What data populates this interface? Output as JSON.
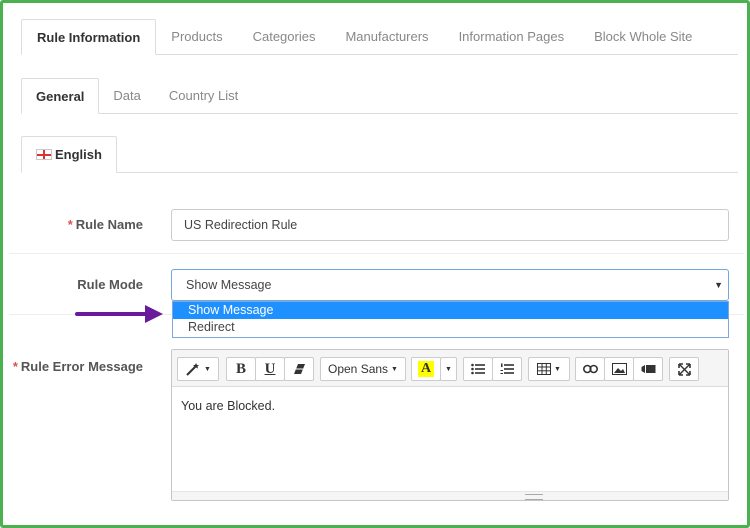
{
  "tabs_main": [
    "Rule Information",
    "Products",
    "Categories",
    "Manufacturers",
    "Information Pages",
    "Block Whole Site"
  ],
  "tabs_sub": [
    "General",
    "Data",
    "Country List"
  ],
  "language_tab": {
    "label": "English",
    "flag": "uk-flag-icon"
  },
  "rule_name": {
    "label": "Rule Name",
    "required_mark": "*",
    "value": "US Redirection Rule"
  },
  "rule_mode": {
    "label": "Rule Mode",
    "selected": "Show Message",
    "caret": "▼",
    "options": [
      "Show Message",
      "Redirect"
    ],
    "highlighted_option": "Show Message"
  },
  "rule_error_message": {
    "label": "Rule Error Message",
    "required_mark": "*",
    "toolbar": {
      "bold": "B",
      "underline": "U",
      "font_name": "Open Sans",
      "font_color_glyph": "A"
    },
    "content": "You are Blocked."
  },
  "colors": {
    "frame_border": "#4caf50",
    "highlight": "#1e90ff",
    "arrow": "#6a1b9a",
    "required": "#d9534f"
  }
}
